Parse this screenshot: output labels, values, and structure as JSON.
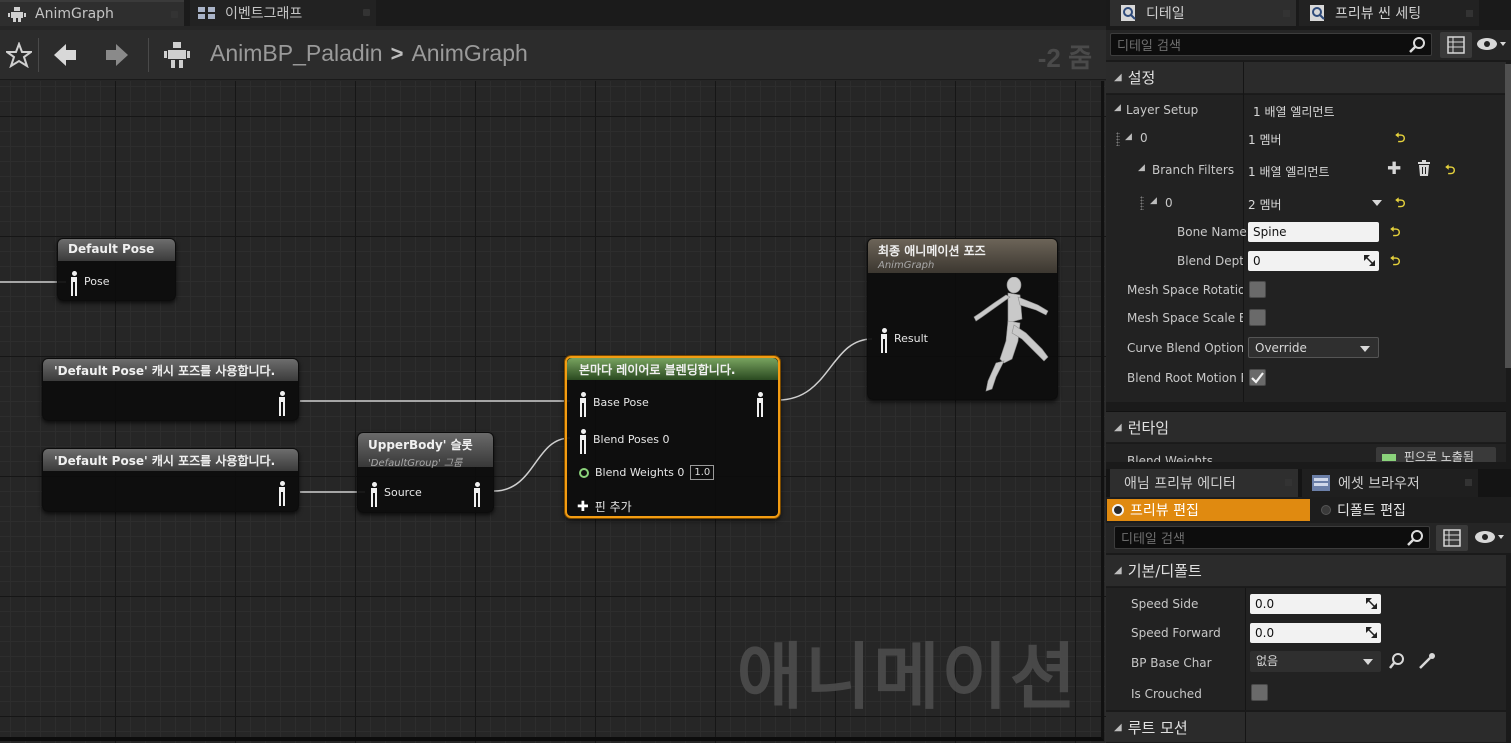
{
  "graph": {
    "tabs": [
      {
        "label": "AnimGraph"
      },
      {
        "label": "이벤트그래프"
      }
    ],
    "breadcrumb": {
      "blueprint": "AnimBP_Paladin",
      "separator": ">",
      "graph": "AnimGraph"
    },
    "zoom_label": "-2 줌",
    "watermark": "애니메이션",
    "nodes": {
      "default_pose": {
        "title": "Default Pose",
        "pin": "Pose"
      },
      "cache_pose_1": {
        "title": "'Default Pose' 캐시 포즈를 사용합니다."
      },
      "cache_pose_2": {
        "title": "'Default Pose' 캐시 포즈를 사용합니다."
      },
      "slot": {
        "title": "UpperBody' 슬롯",
        "subtitle": "'DefaultGroup' 그룹",
        "pin": "Source"
      },
      "blend": {
        "title": "본마다 레이어로 블렌딩합니다.",
        "pin_base": "Base Pose",
        "pin_poses": "Blend Poses 0",
        "pin_weights": "Blend Weights 0",
        "weight_value": "1.0",
        "add_pin": "핀 추가"
      },
      "final": {
        "title": "최종 애니메이션 포즈",
        "subtitle": "AnimGraph",
        "pin": "Result"
      }
    }
  },
  "details": {
    "tabs": [
      {
        "label": "디테일"
      },
      {
        "label": "프리뷰 씬 세팅"
      }
    ],
    "search_placeholder": "디테일 검색",
    "section_settings": "설정",
    "props": {
      "layer_setup": {
        "label": "Layer Setup",
        "value": "1 배열 엘리먼트"
      },
      "index0": {
        "label": "0",
        "value": "1 멤버"
      },
      "branch_filters": {
        "label": "Branch Filters",
        "value": "1 배열 엘리먼트"
      },
      "bf_index0": {
        "label": "0",
        "value": "2 멤버"
      },
      "bone_name": {
        "label": "Bone Name",
        "value": "Spine"
      },
      "blend_depth": {
        "label": "Blend Depth",
        "value": "0"
      },
      "mesh_space_rotation": {
        "label": "Mesh Space Rotation Blend",
        "checked": false
      },
      "mesh_space_scale": {
        "label": "Mesh Space Scale Blend",
        "checked": false
      },
      "curve_blend_option": {
        "label": "Curve Blend Option",
        "value": "Override"
      },
      "blend_root_motion": {
        "label": "Blend Root Motion Based on Root Bone",
        "checked": true
      }
    },
    "section_runtime": "런타임",
    "runtime_partial_label": "Blend Weights",
    "runtime_partial_value": "핀으로 노출됨"
  },
  "preview": {
    "tabs": [
      {
        "label": "애님 프리뷰 에디터"
      },
      {
        "label": "에셋 브라우저"
      }
    ],
    "mode_preview": "프리뷰 편집",
    "mode_default": "디폴트 편집",
    "search_placeholder": "디테일 검색",
    "section_basic": "기본/디폴트",
    "props": {
      "speed_side": {
        "label": "Speed Side",
        "value": "0.0"
      },
      "speed_forward": {
        "label": "Speed Forward",
        "value": "0.0"
      },
      "bp_base_char": {
        "label": "BP Base Char",
        "value": "없음"
      },
      "is_crouched": {
        "label": "Is Crouched",
        "checked": false
      }
    },
    "section_root_motion": "루트 모션"
  },
  "colors": {
    "selection_orange": "#f39c12",
    "blend_header_green": "#5f8f4a",
    "reset_yellow": "#e6d23c",
    "float_pin_green": "#8bd37b",
    "preview_mode_orange": "#e08a10"
  }
}
